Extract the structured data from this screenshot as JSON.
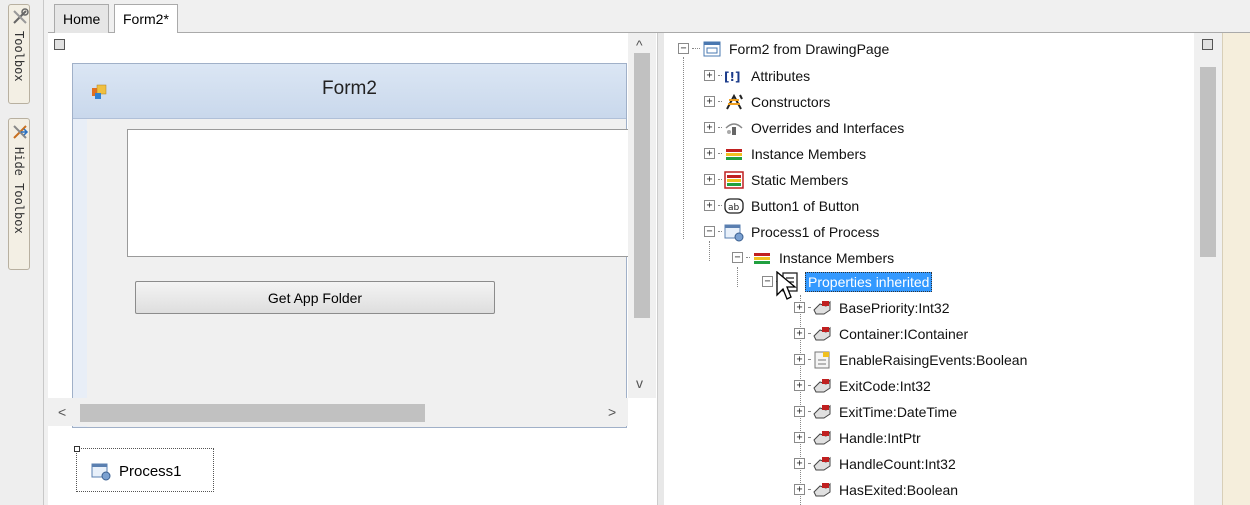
{
  "left_toolbar": {
    "toolbox_label": "Toolbox",
    "hide_toolbox_label": "Hide Toolbox"
  },
  "tabs": [
    {
      "label": "Home"
    },
    {
      "label": "Form2*"
    }
  ],
  "designer": {
    "form_title": "Form2",
    "button_label": "Get App Folder",
    "tray_component": "Process1",
    "scroll_arrows": {
      "up": "^",
      "down": "v",
      "left": "<",
      "right": ">"
    }
  },
  "tree": {
    "root": "Form2 from DrawingPage",
    "items": [
      {
        "label": "Attributes",
        "icon": "attributes-icon"
      },
      {
        "label": "Constructors",
        "icon": "constructors-icon"
      },
      {
        "label": "Overrides and Interfaces",
        "icon": "overrides-icon"
      },
      {
        "label": "Instance Members",
        "icon": "instance-members-icon"
      },
      {
        "label": "Static Members",
        "icon": "static-members-icon"
      },
      {
        "label": "Button1 of Button",
        "icon": "button-ab-icon"
      },
      {
        "label": "Process1 of Process",
        "icon": "process-icon"
      }
    ],
    "process_children": {
      "instance_members": "Instance Members",
      "properties_inherited": "Properties inherited",
      "properties": [
        "BasePriority:Int32",
        "Container:IContainer",
        "EnableRaisingEvents:Boolean",
        "ExitCode:Int32",
        "ExitTime:DateTime",
        "Handle:IntPtr",
        "HandleCount:Int32",
        "HasExited:Boolean"
      ]
    }
  },
  "colors": {
    "selection": "#3399ff",
    "form_title_bg": "#c9d8ec"
  }
}
